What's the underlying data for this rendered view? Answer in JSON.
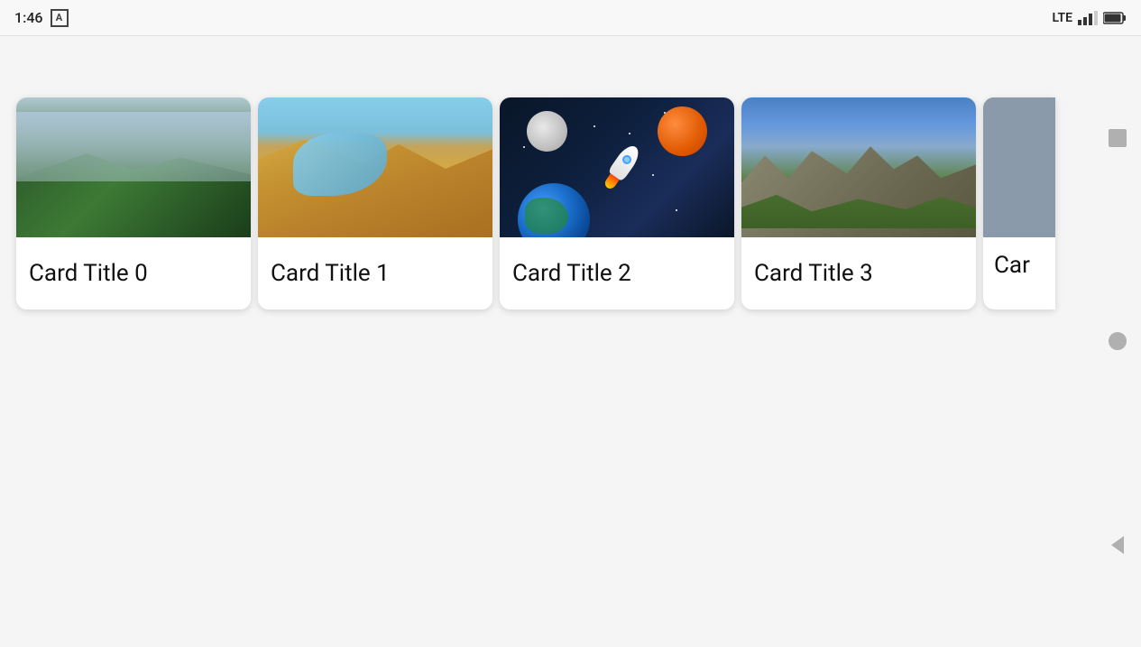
{
  "statusBar": {
    "time": "1:46",
    "iconA": "A",
    "lte": "LTE",
    "signals": [
      4,
      7,
      10,
      13
    ],
    "batteryLevel": 90
  },
  "cards": [
    {
      "id": 0,
      "title": "Card Title 0",
      "imageType": "mountain",
      "imageAlt": "Mountain valley landscape"
    },
    {
      "id": 1,
      "title": "Card Title 1",
      "imageType": "desert",
      "imageAlt": "Sand dunes with water"
    },
    {
      "id": 2,
      "title": "Card Title 2",
      "imageType": "space",
      "imageAlt": "Space with rocket and planets"
    },
    {
      "id": 3,
      "title": "Card Title 3",
      "imageType": "rocks",
      "imageAlt": "Rock formations with greenery"
    },
    {
      "id": 4,
      "title": "Car",
      "imageType": "partial",
      "imageAlt": "Partially visible card"
    }
  ],
  "indicators": {
    "square": "square-indicator",
    "circle": "circle-indicator",
    "triangle": "back-arrow"
  }
}
